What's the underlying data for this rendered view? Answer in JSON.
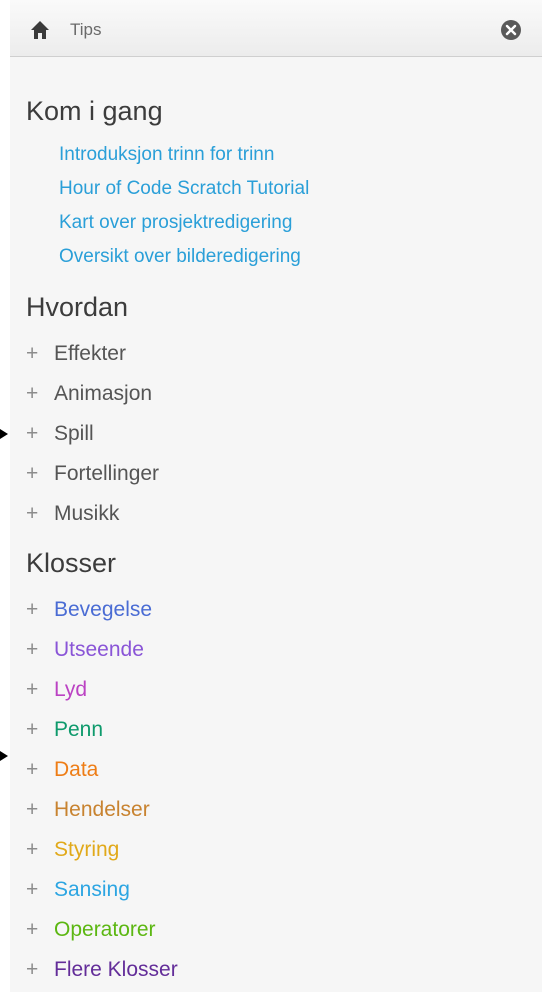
{
  "header": {
    "title": "Tips"
  },
  "sections": {
    "getting_started": {
      "title": "Kom i gang",
      "links": [
        "Introduksjon trinn for trinn",
        "Hour of Code Scratch Tutorial",
        "Kart over prosjektredigering",
        "Oversikt over bilderedigering"
      ]
    },
    "how_to": {
      "title": "Hvordan",
      "items": [
        "Effekter",
        "Animasjon",
        "Spill",
        "Fortellinger",
        "Musikk"
      ]
    },
    "blocks": {
      "title": "Klosser",
      "items": [
        {
          "label": "Bevegelse",
          "color": "#4a6cd4"
        },
        {
          "label": "Utseende",
          "color": "#8a55d7"
        },
        {
          "label": "Lyd",
          "color": "#bb42c3"
        },
        {
          "label": "Penn",
          "color": "#0e9a6c"
        },
        {
          "label": "Data",
          "color": "#ee7d16"
        },
        {
          "label": "Hendelser",
          "color": "#c88330"
        },
        {
          "label": "Styring",
          "color": "#e1a91a"
        },
        {
          "label": "Sansing",
          "color": "#2ca5e2"
        },
        {
          "label": "Operatorer",
          "color": "#5cb712"
        },
        {
          "label": "Flere Klosser",
          "color": "#632d99"
        }
      ]
    }
  },
  "icons": {
    "home": "home-icon",
    "close": "close-icon",
    "expand": "+"
  },
  "colors": {
    "link": "#2a9fd8",
    "panel_bg": "#f6f6f6"
  }
}
